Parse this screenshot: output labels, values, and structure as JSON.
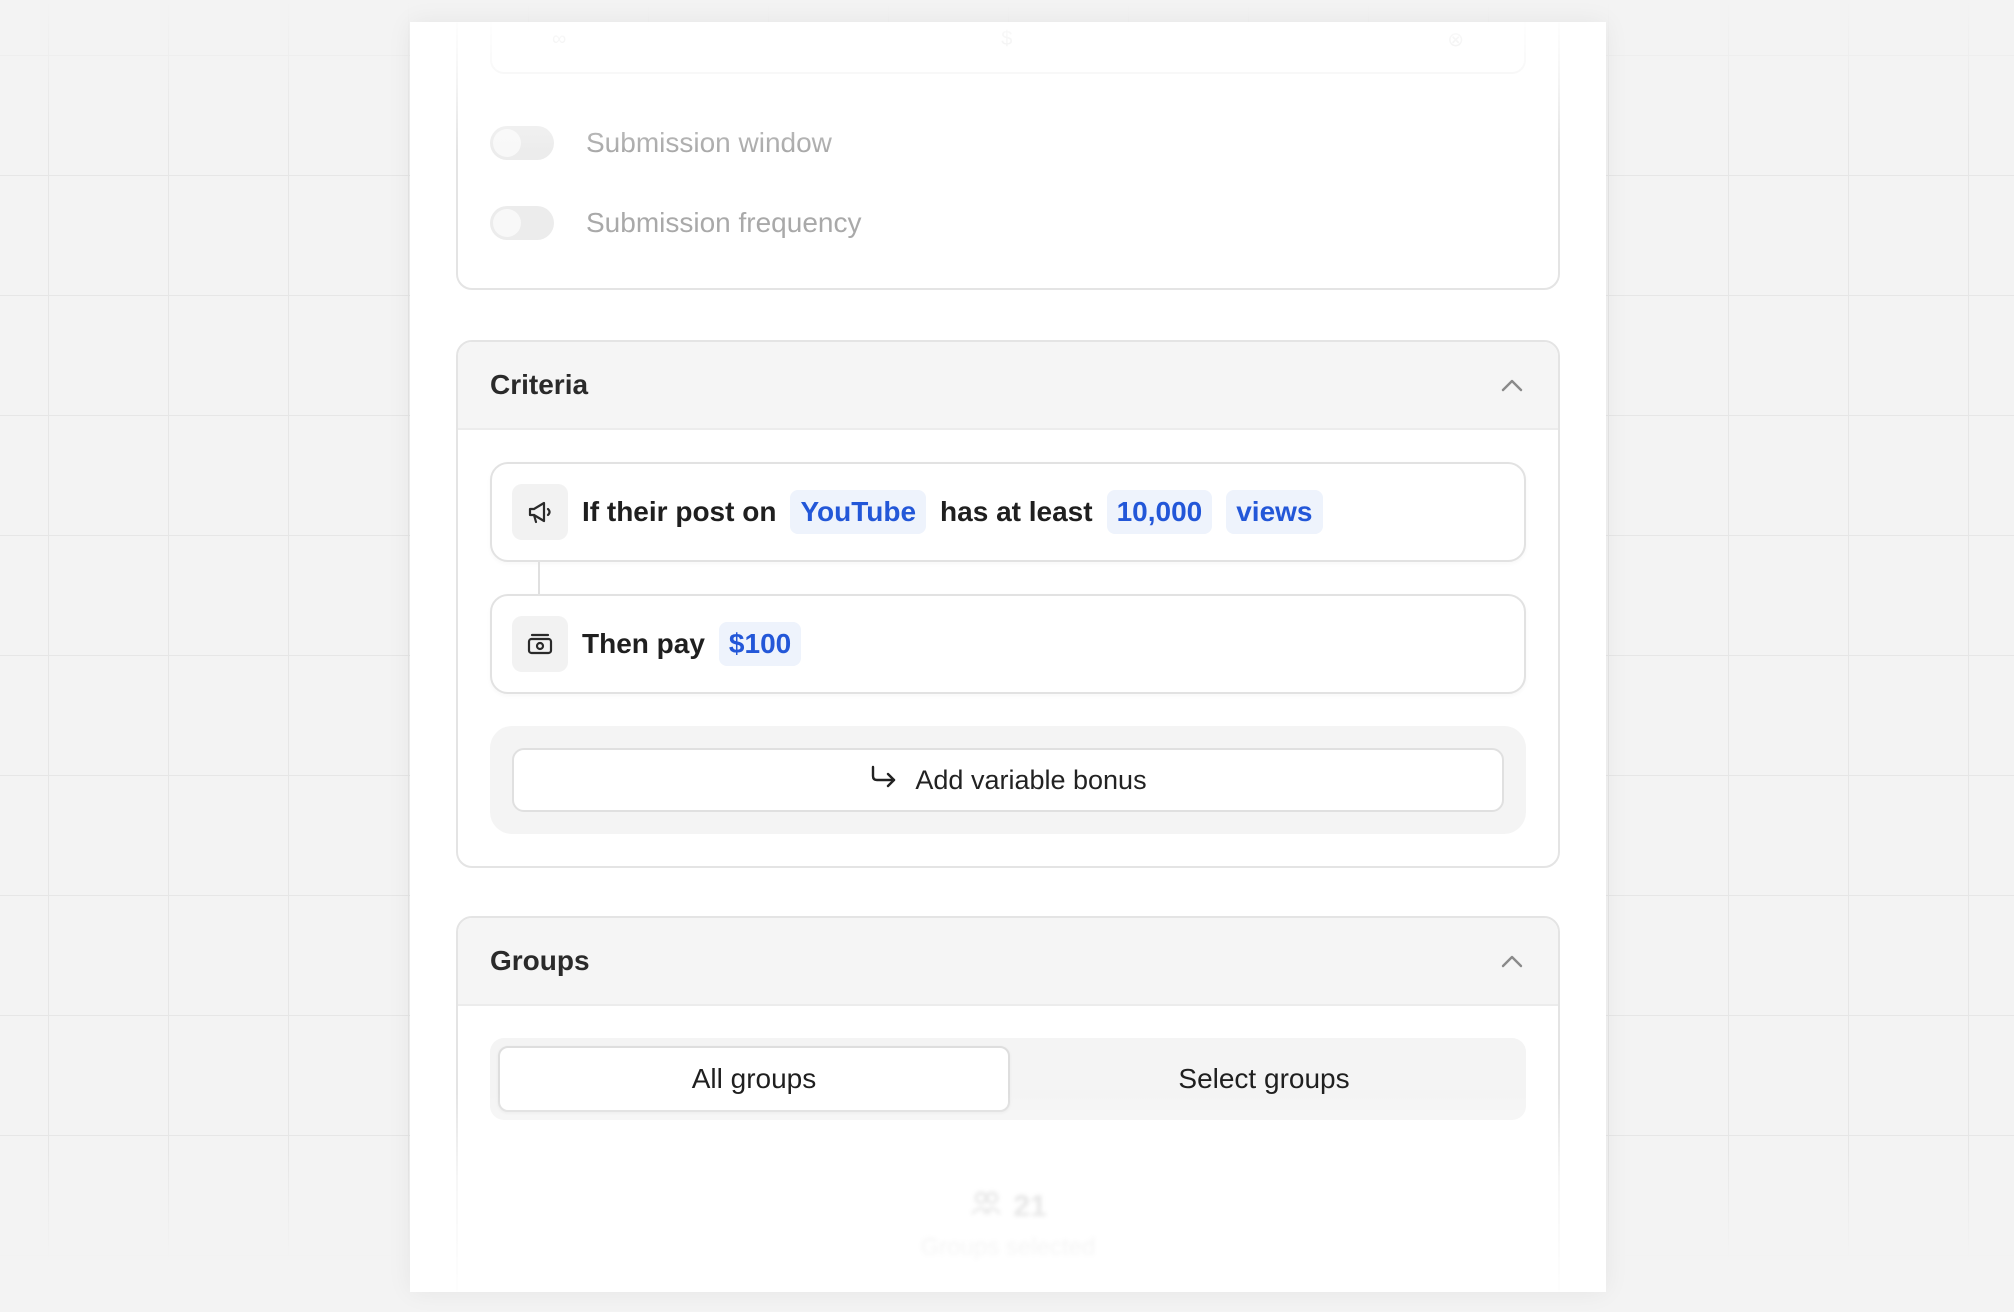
{
  "settings": {
    "strip_values": [
      "∞",
      "$",
      "⊗"
    ],
    "toggles": [
      {
        "label": "Submission window",
        "on": false
      },
      {
        "label": "Submission frequency",
        "on": false
      }
    ]
  },
  "criteria": {
    "title": "Criteria",
    "if_rule": {
      "prefix": "If their post on",
      "platform": "YouTube",
      "middle": "has at least",
      "amount": "10,000",
      "metric": "views"
    },
    "then_rule": {
      "prefix": "Then pay",
      "amount": "$100"
    },
    "add_bonus_label": "Add variable bonus"
  },
  "groups": {
    "title": "Groups",
    "options": [
      {
        "label": "All groups",
        "selected": true
      },
      {
        "label": "Select groups",
        "selected": false
      }
    ],
    "count": "21",
    "count_label": "Groups selected"
  },
  "colors": {
    "accent": "#2357d8",
    "pill_bg": "#eef3fc"
  }
}
